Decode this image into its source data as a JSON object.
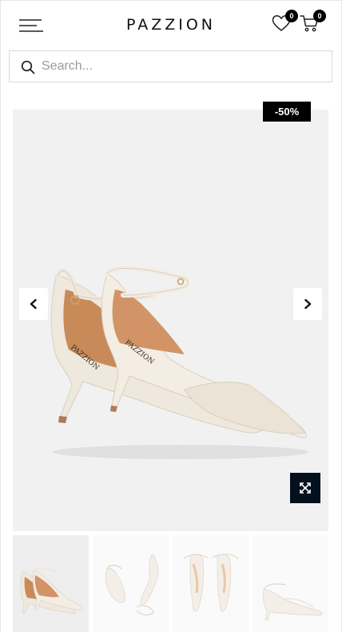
{
  "header": {
    "brand": "PAZZION",
    "wishlist_count": "0",
    "cart_count": "0",
    "menu_icon": "hamburger-menu-icon",
    "wishlist_icon": "heart-icon",
    "cart_icon": "shopping-cart-icon"
  },
  "search": {
    "placeholder": "Search...",
    "value": "",
    "icon": "search-icon"
  },
  "product_gallery": {
    "discount_badge": "-50%",
    "prev_icon": "chevron-left-icon",
    "next_icon": "chevron-right-icon",
    "zoom_icon": "expand-icon",
    "main_image": "cream pointed-toe ankle-strap heels",
    "thumbnails": [
      {
        "label": "pair angled view",
        "active": true
      },
      {
        "label": "top-down flat lay",
        "active": false
      },
      {
        "label": "front toe view",
        "active": false
      },
      {
        "label": "side profile",
        "active": false
      }
    ]
  },
  "colors": {
    "accent_dark": "#05101f",
    "badge_bg": "#000000",
    "gallery_bg": "#f1f1f1",
    "shoe_cream": "#efe8dc"
  }
}
